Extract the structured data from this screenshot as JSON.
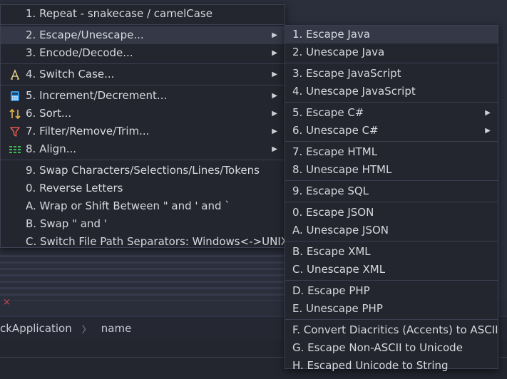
{
  "main_menu": {
    "items": [
      {
        "label": "1. Repeat - snakecase / camelCase"
      },
      {
        "label": "2. Escape/Unescape..."
      },
      {
        "label": "3. Encode/Decode..."
      },
      {
        "label": "4. Switch Case..."
      },
      {
        "label": "5. Increment/Decrement..."
      },
      {
        "label": "6. Sort..."
      },
      {
        "label": "7. Filter/Remove/Trim..."
      },
      {
        "label": "8. Align..."
      },
      {
        "label": "9. Swap Characters/Selections/Lines/Tokens"
      },
      {
        "label": "0. Reverse Letters"
      },
      {
        "label": "A. Wrap or Shift Between \" and ' and `"
      },
      {
        "label": "B. Swap \" and '"
      },
      {
        "label": "C. Switch File Path Separators: Windows<->UNIX"
      }
    ],
    "icons": {
      "switch_case": "letter-a-icon",
      "increment": "calculator-icon",
      "sort": "sort-arrows-icon",
      "filter": "filter-funnel-icon",
      "align": "align-columns-icon"
    }
  },
  "sub_menu": {
    "items": [
      {
        "label": "1. Escape Java"
      },
      {
        "label": "2. Unescape Java"
      },
      {
        "label": "3. Escape JavaScript"
      },
      {
        "label": "4. Unescape JavaScript"
      },
      {
        "label": "5. Escape C#"
      },
      {
        "label": "6. Unescape C#"
      },
      {
        "label": "7. Escape HTML"
      },
      {
        "label": "8. Unescape HTML"
      },
      {
        "label": "9. Escape SQL"
      },
      {
        "label": "0. Escape JSON"
      },
      {
        "label": "A. Unescape JSON"
      },
      {
        "label": "B. Escape XML"
      },
      {
        "label": "C. Unescape XML"
      },
      {
        "label": "D. Escape PHP"
      },
      {
        "label": "E. Unescape PHP"
      },
      {
        "label": "F. Convert Diacritics (Accents) to ASCII"
      },
      {
        "label": "G. Escape Non-ASCII to Unicode"
      },
      {
        "label": "H. Escaped Unicode to String"
      }
    ]
  },
  "breadcrumb": {
    "items": [
      "ckApplication",
      "name"
    ]
  },
  "colors": {
    "menu_bg": "#23252f",
    "highlight": "#343847",
    "calculator": "#3d9be9",
    "sort": "#e8b84a",
    "filter": "#e05a4a",
    "align": "#3fb950"
  }
}
